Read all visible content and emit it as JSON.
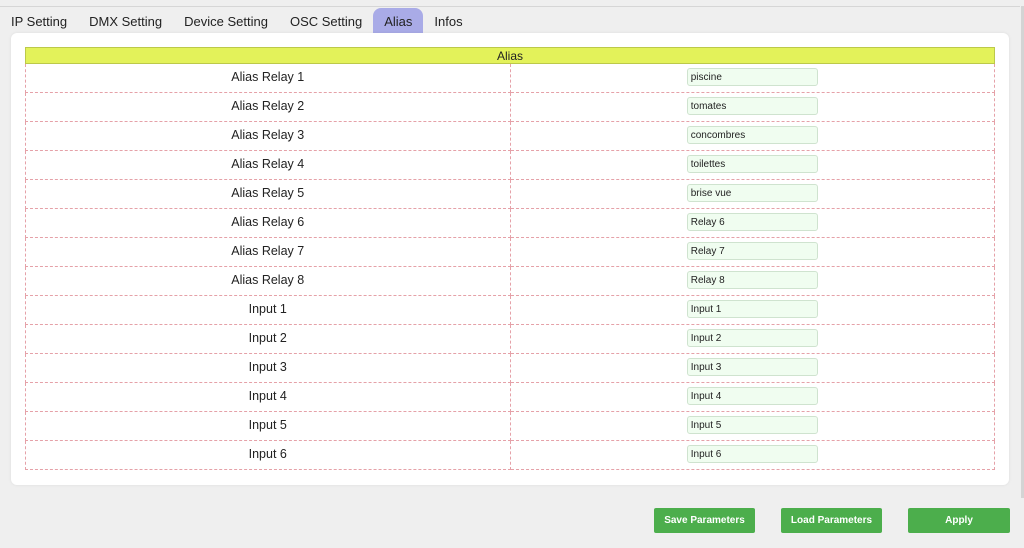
{
  "tabs": [
    {
      "label": "IP Setting",
      "active": false
    },
    {
      "label": "DMX Setting",
      "active": false
    },
    {
      "label": "Device Setting",
      "active": false
    },
    {
      "label": "OSC Setting",
      "active": false
    },
    {
      "label": "Alias",
      "active": true
    },
    {
      "label": "Infos",
      "active": false
    }
  ],
  "alias_table": {
    "header": "Alias",
    "rows": [
      {
        "label": "Alias Relay 1",
        "value": "piscine"
      },
      {
        "label": "Alias Relay 2",
        "value": "tomates"
      },
      {
        "label": "Alias Relay 3",
        "value": "concombres"
      },
      {
        "label": "Alias Relay 4",
        "value": "toilettes"
      },
      {
        "label": "Alias Relay 5",
        "value": "brise vue"
      },
      {
        "label": "Alias Relay 6",
        "value": "Relay 6"
      },
      {
        "label": "Alias Relay 7",
        "value": "Relay 7"
      },
      {
        "label": "Alias Relay 8",
        "value": "Relay 8"
      },
      {
        "label": "Input 1",
        "value": "Input 1"
      },
      {
        "label": "Input 2",
        "value": "Input 2"
      },
      {
        "label": "Input 3",
        "value": "Input 3"
      },
      {
        "label": "Input 4",
        "value": "Input 4"
      },
      {
        "label": "Input 5",
        "value": "Input 5"
      },
      {
        "label": "Input 6",
        "value": "Input 6"
      }
    ]
  },
  "buttons": {
    "save": "Save Parameters",
    "load": "Load Parameters",
    "apply": "Apply"
  },
  "colors": {
    "active_tab": "#a9abe7",
    "table_header": "#e3f25a",
    "button": "#4cae4c",
    "input_background": "#f0fdf0",
    "row_border": "#e5a1a8"
  }
}
